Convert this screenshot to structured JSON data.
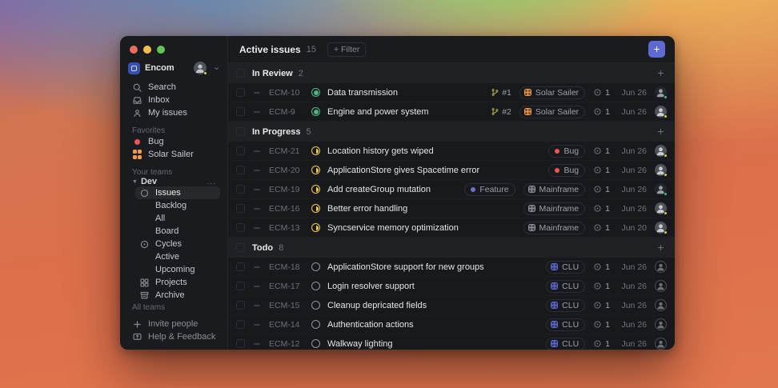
{
  "colors": {
    "accent": "#5e6ad2",
    "status_review": "#4cb782",
    "status_progress": "#f2c94c",
    "status_todo": "#8f959e",
    "presence_green": "#c9da4e",
    "presence_teal": "#35bda0",
    "traffic": [
      "#ed6a5f",
      "#f5bd4f",
      "#61c454"
    ]
  },
  "sidebar": {
    "workspace": {
      "name": "Encom"
    },
    "nav": [
      {
        "icon": "search-icon",
        "label": "Search"
      },
      {
        "icon": "inbox-icon",
        "label": "Inbox"
      },
      {
        "icon": "my-issues-icon",
        "label": "My issues"
      }
    ],
    "favorites_label": "Favorites",
    "favorites": [
      {
        "icon": "bug-dot-icon",
        "label": "Bug",
        "color": "#eb5757"
      },
      {
        "icon": "solar-sailer-grid-icon",
        "label": "Solar Sailer",
        "color": "#f2994a"
      }
    ],
    "teams_label": "Your teams",
    "team": {
      "name": "Dev",
      "more": "..."
    },
    "team_items": [
      {
        "label": "Issues",
        "icon": "issues-circle-icon",
        "selected": true
      },
      {
        "label": "Backlog"
      },
      {
        "label": "All"
      },
      {
        "label": "Board"
      },
      {
        "label": "Cycles",
        "icon": "cycles-icon"
      },
      {
        "label": "Active"
      },
      {
        "label": "Upcoming"
      },
      {
        "label": "Projects",
        "icon": "projects-icon"
      },
      {
        "label": "Archive",
        "icon": "archive-icon"
      }
    ],
    "all_teams_label": "All teams",
    "footer": [
      {
        "icon": "plus-icon",
        "label": "Invite people"
      },
      {
        "icon": "help-icon",
        "label": "Help & Feedback"
      }
    ]
  },
  "header": {
    "title": "Active issues",
    "count": "15",
    "filter_label": "+ Filter"
  },
  "labels": {
    "Bug": "#eb5757",
    "Feature": "#6d6fd1"
  },
  "projects": {
    "Solar Sailer": "#f2994a",
    "Mainframe": "#8a8f98",
    "CLU": "#5e6ad2"
  },
  "sections": [
    {
      "name": "In Review",
      "count": "2",
      "status": "review",
      "rows": [
        {
          "id": "ECM-10",
          "title": "Data transmission",
          "pr": "#1",
          "project": "Solar Sailer",
          "cycle": "1",
          "date": "Jun 26",
          "avatar": "dark",
          "presence": "#35bda0"
        },
        {
          "id": "ECM-9",
          "title": "Engine and power system",
          "pr": "#2",
          "project": "Solar Sailer",
          "cycle": "1",
          "date": "Jun 26",
          "avatar": "grey",
          "presence": "#c9da4e"
        }
      ]
    },
    {
      "name": "In Progress",
      "count": "5",
      "status": "progress",
      "rows": [
        {
          "id": "ECM-21",
          "title": "Location history gets wiped",
          "label": "Bug",
          "cycle": "1",
          "date": "Jun 26",
          "avatar": "grey",
          "presence": "#c9da4e"
        },
        {
          "id": "ECM-20",
          "title": "ApplicationStore gives Spacetime error",
          "label": "Bug",
          "cycle": "1",
          "date": "Jun 26",
          "avatar": "grey",
          "presence": "#c9da4e"
        },
        {
          "id": "ECM-19",
          "title": "Add createGroup mutation",
          "label": "Feature",
          "project": "Mainframe",
          "cycle": "1",
          "date": "Jun 26",
          "avatar": "dark",
          "presence": "#35bda0"
        },
        {
          "id": "ECM-16",
          "title": "Better error handling",
          "project": "Mainframe",
          "cycle": "1",
          "date": "Jun 26",
          "avatar": "grey",
          "presence": "#c9da4e"
        },
        {
          "id": "ECM-13",
          "title": "Syncservice memory optimization",
          "project": "Mainframe",
          "cycle": "1",
          "date": "Jun 20",
          "avatar": "grey",
          "presence": "#c9da4e"
        }
      ]
    },
    {
      "name": "Todo",
      "count": "8",
      "status": "todo",
      "rows": [
        {
          "id": "ECM-18",
          "title": "ApplicationStore support for new groups",
          "project": "CLU",
          "cycle": "1",
          "date": "Jun 26",
          "avatar": "none"
        },
        {
          "id": "ECM-17",
          "title": "Login resolver support",
          "project": "CLU",
          "cycle": "1",
          "date": "Jun 26",
          "avatar": "none"
        },
        {
          "id": "ECM-15",
          "title": "Cleanup depricated fields",
          "project": "CLU",
          "cycle": "1",
          "date": "Jun 26",
          "avatar": "none"
        },
        {
          "id": "ECM-14",
          "title": "Authentication actions",
          "project": "CLU",
          "cycle": "1",
          "date": "Jun 26",
          "avatar": "none"
        },
        {
          "id": "ECM-12",
          "title": "Walkway lighting",
          "project": "CLU",
          "cycle": "1",
          "date": "Jun 26",
          "avatar": "none"
        }
      ]
    }
  ]
}
